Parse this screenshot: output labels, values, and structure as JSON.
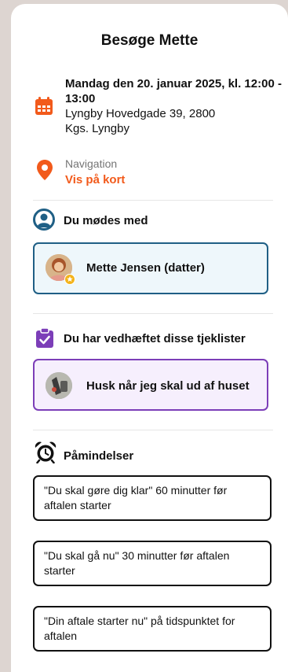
{
  "title": "Besøge Mette",
  "appointment": {
    "datetime": "Mandag den 20. januar 2025, kl. 12:00 - 13:00",
    "address_line1": "Lyngby Hovedgade 39, 2800",
    "address_line2": "Kgs. Lyngby"
  },
  "navigation": {
    "label": "Navigation",
    "link": "Vis på kort"
  },
  "meet": {
    "heading": "Du mødes med",
    "person": "Mette Jensen (datter)"
  },
  "checklists": {
    "heading": "Du har vedhæftet disse tjeklister",
    "item": "Husk når jeg skal ud af huset"
  },
  "reminders": {
    "heading": "Påmindelser",
    "items": [
      "\"Du skal gøre dig klar\" 60 minutter før aftalen starter",
      "\"Du skal gå nu\" 30 minutter før aftalen starter",
      "\"Din aftale starter nu\" på tidspunktet for aftalen"
    ]
  },
  "colors": {
    "accent_orange": "#f25a1b",
    "person_border": "#1f5f85",
    "person_bg": "#eef7fb",
    "checklist_border": "#7c3eb8",
    "checklist_bg": "#f6effd"
  },
  "icons": [
    "calendar-icon",
    "location-pin-icon",
    "user-circle-icon",
    "clipboard-check-icon",
    "alarm-clock-icon",
    "star-badge-icon"
  ]
}
